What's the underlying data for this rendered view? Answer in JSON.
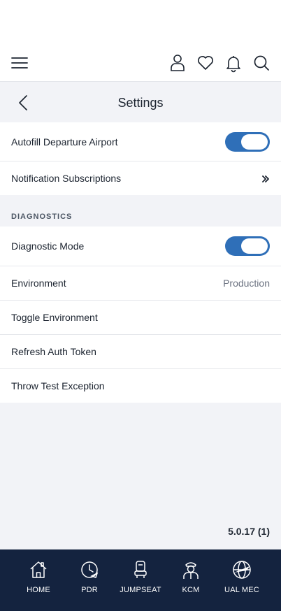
{
  "header": {
    "menu_icon": "hamburger-menu-icon",
    "profile_icon": "user-icon",
    "favorites_icon": "heart-icon",
    "notifications_icon": "bell-icon",
    "search_icon": "search-icon"
  },
  "nav": {
    "title": "Settings",
    "back_icon": "chevron-left-icon"
  },
  "settings": {
    "autofill": {
      "label": "Autofill Departure Airport",
      "enabled": true
    },
    "notifications": {
      "label": "Notification Subscriptions"
    }
  },
  "diagnostics": {
    "section_title": "DIAGNOSTICS",
    "diagnostic_mode": {
      "label": "Diagnostic Mode",
      "enabled": true
    },
    "environment": {
      "label": "Environment",
      "value": "Production"
    },
    "toggle_environment": {
      "label": "Toggle Environment"
    },
    "refresh_auth_token": {
      "label": "Refresh Auth Token"
    },
    "throw_test_exception": {
      "label": "Throw Test Exception"
    }
  },
  "version": "5.0.17 (1)",
  "tabbar": {
    "items": [
      {
        "label": "HOME",
        "icon": "house-icon"
      },
      {
        "label": "PDR",
        "icon": "clock-plane-icon"
      },
      {
        "label": "JUMPSEAT",
        "icon": "seat-icon"
      },
      {
        "label": "KCM",
        "icon": "pilot-icon"
      },
      {
        "label": "UAL MEC",
        "icon": "alpa-globe-icon"
      }
    ]
  },
  "colors": {
    "accent": "#2f6fb8",
    "tabbar_bg": "#14233f",
    "page_bg": "#f2f3f7"
  }
}
